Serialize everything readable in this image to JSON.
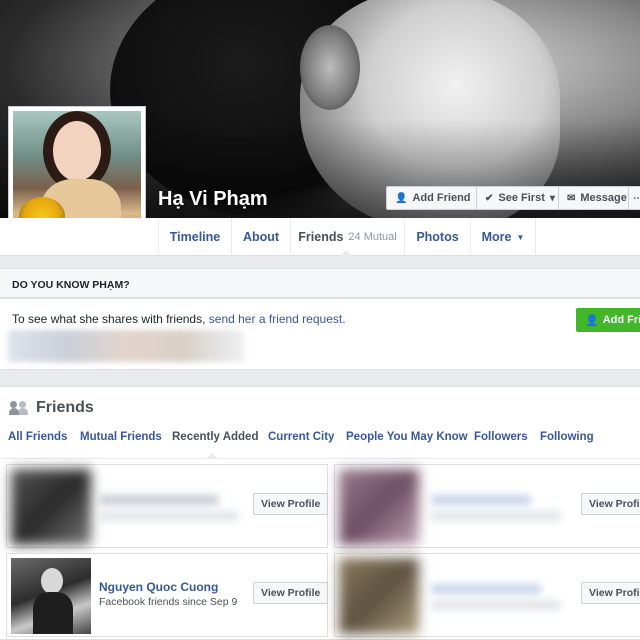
{
  "profile": {
    "name": "Hạ Vi Phạm"
  },
  "cover_buttons": {
    "add_friend": "Add Friend",
    "see_first": "See First",
    "message": "Message"
  },
  "nav": {
    "timeline": "Timeline",
    "about": "About",
    "friends": "Friends",
    "friends_mutual": "24 Mutual",
    "photos": "Photos",
    "more": "More"
  },
  "do_you_know": {
    "heading": "DO YOU KNOW PHẠM?",
    "text": "To see what she shares with friends,",
    "link": "send her a friend request.",
    "button": "Add Friend"
  },
  "friends": {
    "title": "Friends",
    "tabs": [
      "All Friends",
      "Mutual Friends",
      "Recently Added",
      "Current City",
      "People You May Know",
      "Followers",
      "Following"
    ],
    "active_tab": "Recently Added",
    "view_profile": "View Profile",
    "cards": [
      {
        "name": "",
        "subtitle": ""
      },
      {
        "name": "",
        "subtitle": ""
      },
      {
        "name": "Nguyen Quoc Cuong",
        "subtitle": "Facebook friends since Sep 9"
      },
      {
        "name": "",
        "subtitle": ""
      }
    ]
  },
  "colors": {
    "link": "#365899",
    "green": "#42b72a",
    "page_bg": "#e9ebee"
  }
}
